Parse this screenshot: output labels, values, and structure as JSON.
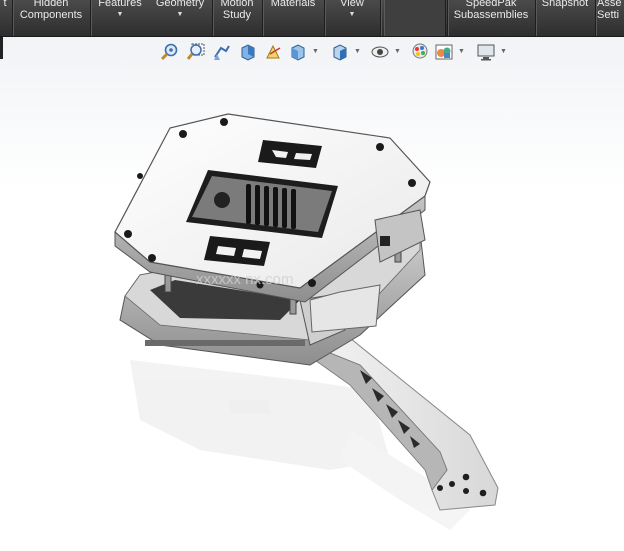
{
  "ribbon": {
    "items": [
      {
        "label": "Hidden\nComponents"
      },
      {
        "label": "Features"
      },
      {
        "label": "Geometry"
      },
      {
        "label": "Motion\nStudy"
      },
      {
        "label": "Materials"
      },
      {
        "label": "View"
      },
      {
        "label": "SpeedPak\nSubassemblies"
      },
      {
        "label": "Snapshot"
      },
      {
        "label": "Asse\nSetti"
      }
    ]
  },
  "heads_up_toolbar": {
    "icons": [
      "zoom-to-fit-icon",
      "zoom-to-area-icon",
      "previous-view-icon",
      "section-view-icon",
      "dynamic-annotation-icon",
      "view-orientation-icon",
      "display-style-icon",
      "hide-show-items-icon",
      "edit-appearance-icon",
      "apply-scene-icon",
      "view-settings-icon"
    ]
  },
  "watermark": {
    "text": "xxxxxx  nx.com"
  },
  "colors": {
    "ribbon_bg": "#3a3a3a",
    "ribbon_text": "#eaeaea",
    "model_face": "#f2f2f2",
    "model_dark": "#1e1e1e"
  }
}
